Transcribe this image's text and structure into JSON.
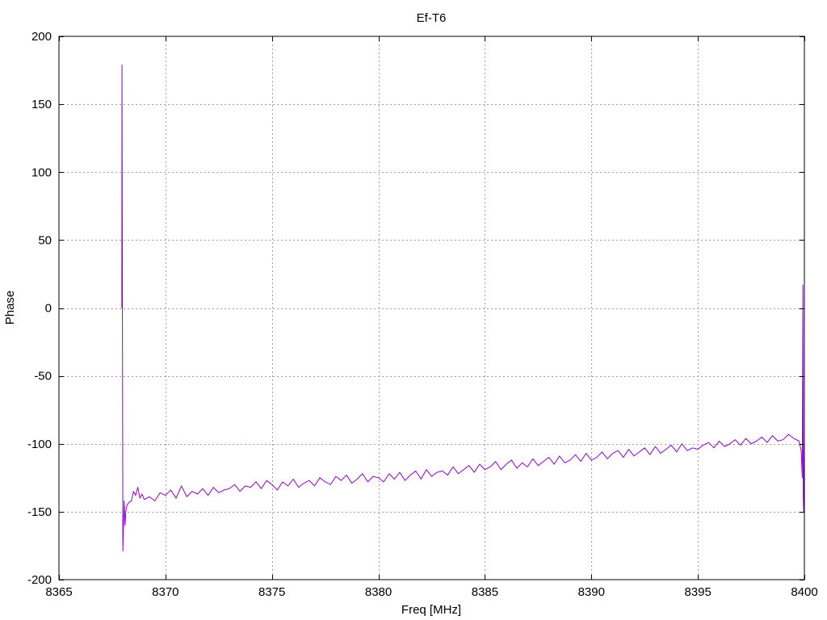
{
  "chart_data": {
    "type": "line",
    "title": "Ef-T6",
    "xlabel": "Freq [MHz]",
    "ylabel": "Phase",
    "xlim": [
      8365,
      8400
    ],
    "ylim": [
      -200,
      200
    ],
    "grid": true,
    "xticks": [
      8365,
      8370,
      8375,
      8380,
      8385,
      8390,
      8395,
      8400
    ],
    "yticks": [
      -200,
      -150,
      -100,
      -50,
      0,
      50,
      100,
      150,
      200
    ],
    "xtick_labels": [
      "8365",
      "8370",
      "8375",
      "8380",
      "8385",
      "8390",
      "8395",
      "8400"
    ],
    "ytick_labels": [
      "-200",
      "-150",
      "-100",
      "-50",
      "0",
      "50",
      "100",
      "150",
      "200"
    ],
    "series": [
      {
        "color": "#9400d3",
        "x": [
          8367.95,
          8367.96,
          8367.98,
          8368.0,
          8368.02,
          8368.06,
          8368.1,
          8368.15,
          8368.2,
          8368.3,
          8368.4,
          8368.5,
          8368.6,
          8368.7,
          8368.8,
          8368.9,
          8369.0,
          8369.25,
          8369.5,
          8369.75,
          8370.0,
          8370.25,
          8370.5,
          8370.75,
          8371.0,
          8371.25,
          8371.5,
          8371.75,
          8372.0,
          8372.25,
          8372.5,
          8372.75,
          8373.0,
          8373.25,
          8373.5,
          8373.75,
          8374.0,
          8374.25,
          8374.5,
          8374.75,
          8375.0,
          8375.25,
          8375.5,
          8375.75,
          8376.0,
          8376.25,
          8376.5,
          8376.75,
          8377.0,
          8377.25,
          8377.5,
          8377.75,
          8378.0,
          8378.25,
          8378.5,
          8378.75,
          8379.0,
          8379.25,
          8379.5,
          8379.75,
          8380.0,
          8380.25,
          8380.5,
          8380.75,
          8381.0,
          8381.25,
          8381.5,
          8381.75,
          8382.0,
          8382.25,
          8382.5,
          8382.75,
          8383.0,
          8383.25,
          8383.5,
          8383.75,
          8384.0,
          8384.25,
          8384.5,
          8384.75,
          8385.0,
          8385.25,
          8385.5,
          8385.75,
          8386.0,
          8386.25,
          8386.5,
          8386.75,
          8387.0,
          8387.25,
          8387.5,
          8387.75,
          8388.0,
          8388.25,
          8388.5,
          8388.75,
          8389.0,
          8389.25,
          8389.5,
          8389.75,
          8390.0,
          8390.25,
          8390.5,
          8390.75,
          8391.0,
          8391.25,
          8391.5,
          8391.75,
          8392.0,
          8392.25,
          8392.5,
          8392.75,
          8393.0,
          8393.25,
          8393.5,
          8393.75,
          8394.0,
          8394.25,
          8394.5,
          8394.75,
          8395.0,
          8395.25,
          8395.5,
          8395.75,
          8396.0,
          8396.25,
          8396.5,
          8396.75,
          8397.0,
          8397.25,
          8397.5,
          8397.75,
          8398.0,
          8398.25,
          8398.5,
          8398.75,
          8399.0,
          8399.25,
          8399.5,
          8399.75,
          8399.85,
          8399.9,
          8399.93,
          8399.95,
          8399.97,
          8400.0
        ],
        "y": [
          0,
          179,
          0,
          -179,
          -165,
          -142,
          -160,
          -148,
          -145,
          -143,
          -142,
          -135,
          -138,
          -132,
          -140,
          -137,
          -141,
          -139,
          -142,
          -136,
          -138,
          -134,
          -140,
          -131,
          -139,
          -135,
          -137,
          -133,
          -138,
          -132,
          -136,
          -134,
          -133,
          -130,
          -135,
          -131,
          -132,
          -128,
          -133,
          -127,
          -130,
          -134,
          -128,
          -131,
          -126,
          -132,
          -129,
          -127,
          -131,
          -125,
          -128,
          -130,
          -124,
          -127,
          -123,
          -129,
          -126,
          -122,
          -128,
          -124,
          -125,
          -128,
          -122,
          -126,
          -121,
          -127,
          -123,
          -120,
          -126,
          -119,
          -124,
          -121,
          -120,
          -123,
          -117,
          -122,
          -119,
          -116,
          -121,
          -115,
          -119,
          -117,
          -113,
          -119,
          -115,
          -112,
          -118,
          -114,
          -117,
          -111,
          -116,
          -113,
          -110,
          -115,
          -109,
          -114,
          -112,
          -108,
          -113,
          -107,
          -112,
          -110,
          -106,
          -111,
          -107,
          -105,
          -110,
          -104,
          -109,
          -106,
          -103,
          -108,
          -102,
          -107,
          -104,
          -101,
          -106,
          -100,
          -105,
          -103,
          -104,
          -101,
          -99,
          -103,
          -98,
          -102,
          -100,
          -97,
          -101,
          -96,
          -100,
          -98,
          -95,
          -99,
          -94,
          -98,
          -97,
          -93,
          -96,
          -98,
          -105,
          -125,
          17,
          -140,
          -150,
          -95
        ]
      }
    ]
  }
}
